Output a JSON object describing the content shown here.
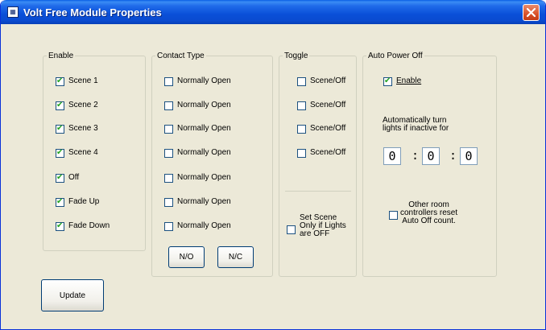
{
  "window": {
    "title": "Volt Free Module Properties"
  },
  "enable": {
    "legend": "Enable",
    "items": [
      {
        "label": "Scene 1",
        "checked": true
      },
      {
        "label": "Scene 2",
        "checked": true
      },
      {
        "label": "Scene 3",
        "checked": true
      },
      {
        "label": "Scene 4",
        "checked": true
      },
      {
        "label": "Off",
        "checked": true
      },
      {
        "label": "Fade Up",
        "checked": true
      },
      {
        "label": "Fade Down",
        "checked": true
      }
    ]
  },
  "contact_type": {
    "legend": "Contact Type",
    "items": [
      {
        "label": "Normally Open",
        "checked": false
      },
      {
        "label": "Normally Open",
        "checked": false
      },
      {
        "label": "Normally Open",
        "checked": false
      },
      {
        "label": "Normally Open",
        "checked": false
      },
      {
        "label": "Normally Open",
        "checked": false
      },
      {
        "label": "Normally Open",
        "checked": false
      },
      {
        "label": "Normally Open",
        "checked": false
      }
    ],
    "no_button": "N/O",
    "nc_button": "N/C"
  },
  "toggle": {
    "legend": "Toggle",
    "items": [
      {
        "label": "Scene/Off",
        "checked": false
      },
      {
        "label": "Scene/Off",
        "checked": false
      },
      {
        "label": "Scene/Off",
        "checked": false
      },
      {
        "label": "Scene/Off",
        "checked": false
      }
    ],
    "set_scene": {
      "line1": "Set Scene",
      "line2": "Only if Lights",
      "line3": "are OFF",
      "checked": false
    }
  },
  "auto_power_off": {
    "legend": "Auto Power Off",
    "enable": {
      "label": "Enable",
      "checked": true
    },
    "desc_line1": "Automatically turn",
    "desc_line2": "lights if inactive for",
    "time": {
      "hours": "0",
      "minutes": "0",
      "seconds": "0",
      "separator": ":"
    },
    "other": {
      "line1": "Other room",
      "line2": "controllers reset",
      "line3": "Auto Off count.",
      "checked": false
    }
  },
  "update_button": "Update",
  "colors": {
    "titlebar": "#0a4fd8",
    "window_bg": "#ece9d8",
    "check": "#21a121",
    "close": "#d9522a"
  }
}
